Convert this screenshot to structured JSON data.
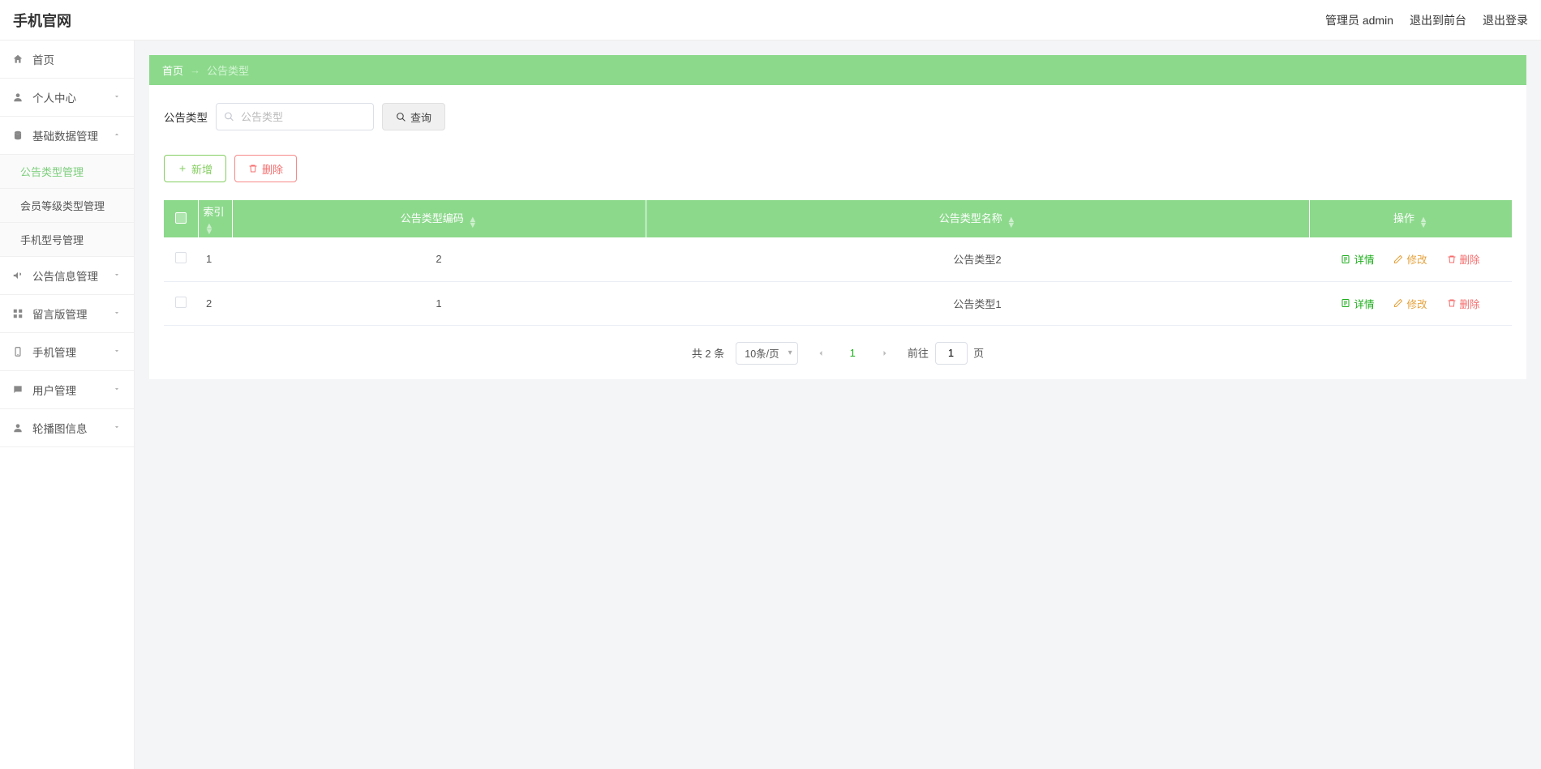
{
  "header": {
    "logo": "手机官网",
    "admin_label": "管理员 admin",
    "exit_front_label": "退出到前台",
    "logout_label": "退出登录"
  },
  "sidebar": {
    "home_label": "首页",
    "items": [
      {
        "label": "个人中心",
        "open": false
      },
      {
        "label": "基础数据管理",
        "open": true,
        "children": [
          {
            "label": "公告类型管理",
            "active": true
          },
          {
            "label": "会员等级类型管理",
            "active": false
          },
          {
            "label": "手机型号管理",
            "active": false
          }
        ]
      },
      {
        "label": "公告信息管理",
        "open": false
      },
      {
        "label": "留言版管理",
        "open": false
      },
      {
        "label": "手机管理",
        "open": false
      },
      {
        "label": "用户管理",
        "open": false
      },
      {
        "label": "轮播图信息",
        "open": false
      }
    ]
  },
  "breadcrumb": {
    "home": "首页",
    "sep": "→",
    "current": "公告类型"
  },
  "search": {
    "label": "公告类型",
    "placeholder": "公告类型",
    "query_btn": "查询"
  },
  "actions": {
    "add": "新增",
    "delete": "删除"
  },
  "table": {
    "headers": {
      "index": "索引",
      "code": "公告类型编码",
      "name": "公告类型名称",
      "ops": "操作"
    },
    "rows": [
      {
        "idx": "1",
        "code": "2",
        "name": "公告类型2"
      },
      {
        "idx": "2",
        "code": "1",
        "name": "公告类型1"
      }
    ],
    "row_ops": {
      "detail": "详情",
      "edit": "修改",
      "delete": "删除"
    }
  },
  "pagination": {
    "total_text": "共 2 条",
    "page_size": "10条/页",
    "current_page": "1",
    "jump_prefix": "前往",
    "jump_value": "1",
    "jump_suffix": "页"
  }
}
